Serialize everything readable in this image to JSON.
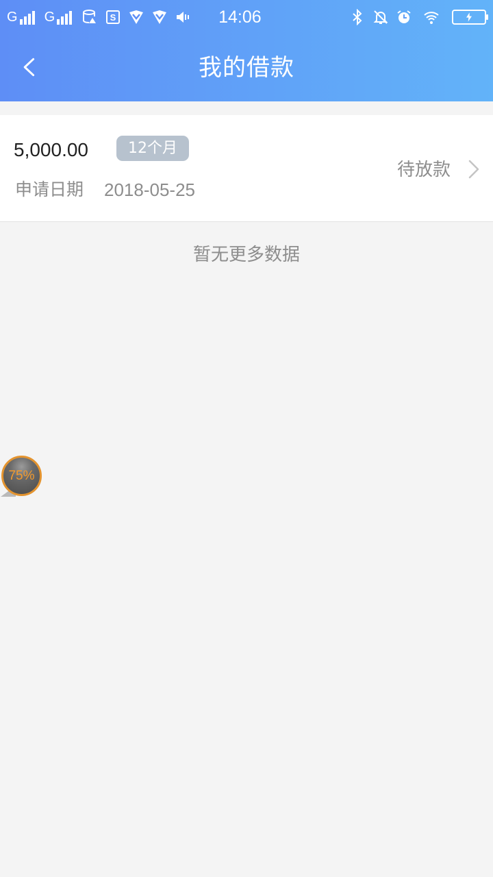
{
  "status_bar": {
    "carrier1": "G",
    "carrier2": "G",
    "time": "14:06",
    "icons_left": [
      "signal-icon",
      "signal-icon",
      "data-icon",
      "storage-icon",
      "vpn-icon",
      "vpn-icon",
      "volume-icon"
    ],
    "icons_right": [
      "bluetooth-icon",
      "mute-bell-icon",
      "alarm-icon",
      "wifi-icon",
      "battery-charging-icon"
    ]
  },
  "header": {
    "title": "我的借款",
    "back_icon": "chevron-left-icon",
    "gradient_start": "#5e8ef6",
    "gradient_end": "#62b3f9"
  },
  "loan": {
    "amount": "5,000.00",
    "term": "12个月",
    "date_label": "申请日期",
    "date": "2018-05-25",
    "status": "待放款"
  },
  "empty_text": "暂无更多数据",
  "float_ball": {
    "label": "75%",
    "accent": "#f29a2e"
  }
}
